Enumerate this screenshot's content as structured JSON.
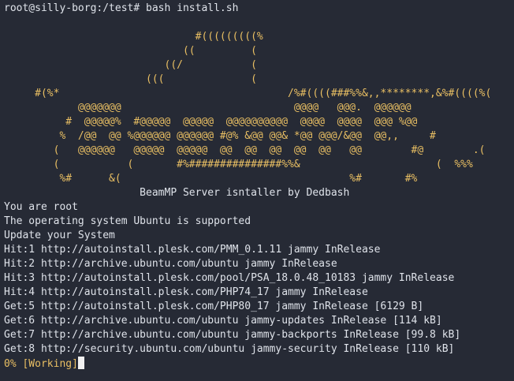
{
  "prompt": {
    "user_host_path": "root@silly-borg:/test#",
    "command": "bash install.sh"
  },
  "ascii_art": [
    "                               #(((((((((%",
    "                             ((         (",
    "                          ((/           (",
    "                       (((              (",
    "     #(%*                                     /%#((((###%%&,,********,&%#((((%(",
    "            @@@@@@@                            @@@@   @@@.  @@@@@@",
    "          #  @@@@@%  #@@@@@  @@@@@  @@@@@@@@@@  @@@@  @@@@  @@@ %@@",
    "         %  /@@  @@ %@@@@@@ @@@@@@ #@% &@@ @@& *@@ @@@/&@@  @@,,     #",
    "        (   @@@@@@   @@@@@  @@@@@  @@  @@  @@  @@  @@   @@        #@        .(",
    "        (           (       #%###############%%&                      (  %%%",
    "         %#      &(                                     %#       #%"
  ],
  "title_line": "                      BeamMP Server isntaller by Dedbash",
  "output_lines": [
    "You are root",
    "The operating system Ubuntu is supported",
    "Update your System",
    "Hit:1 http://autoinstall.plesk.com/PMM_0.1.11 jammy InRelease",
    "Hit:2 http://archive.ubuntu.com/ubuntu jammy InRelease",
    "Hit:3 http://autoinstall.plesk.com/pool/PSA_18.0.48_10183 jammy InRelease",
    "Hit:4 http://autoinstall.plesk.com/PHP74_17 jammy InRelease",
    "Get:5 http://autoinstall.plesk.com/PHP80_17 jammy InRelease [6129 B]",
    "Get:6 http://archive.ubuntu.com/ubuntu jammy-updates InRelease [114 kB]",
    "Get:7 http://archive.ubuntu.com/ubuntu jammy-backports InRelease [99.8 kB]",
    "Get:8 http://security.ubuntu.com/ubuntu jammy-security InRelease [110 kB]"
  ],
  "status": {
    "percent": "0%",
    "label": "[Working]"
  },
  "colors": {
    "background": "#262a35",
    "foreground": "#dfe3ea",
    "art": "#e9bf63"
  }
}
